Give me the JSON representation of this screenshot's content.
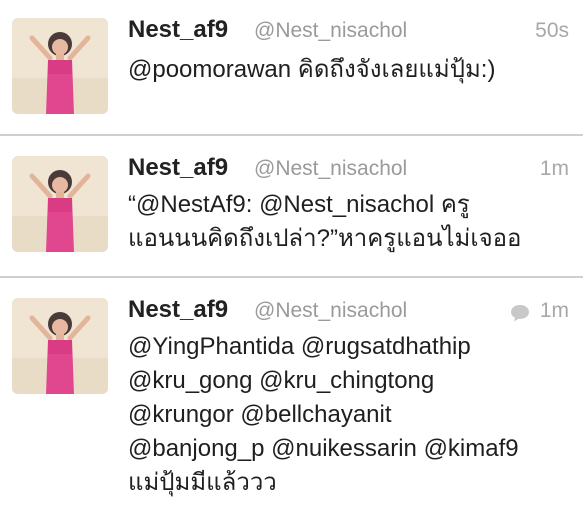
{
  "tweets": [
    {
      "name": "Nest_af9",
      "handle": "@Nest_nisachol",
      "time": "50s",
      "lines": [
        "@poomorawan คิดถึงจังเลยแม่ปุ้ม:)"
      ]
    },
    {
      "name": "Nest_af9",
      "handle": "@Nest_nisachol",
      "time": "1m",
      "lines": [
        "“@NestAf9: @Nest_nisachol ครู",
        "แอนนนคิดถึงเปล่า?”หาครูแอนไม่เจออ"
      ]
    },
    {
      "name": "Nest_af9",
      "handle": "@Nest_nisachol",
      "time": "1m",
      "reply_icon": "conversation-bubble-icon",
      "lines": [
        "@YingPhantida @rugsatdhathip",
        "@kru_gong @kru_chingtong",
        "@krungor @bellchayanit",
        "@banjong_p @nuikessarin @kimaf9",
        "แม่ปุ้มมีแล้ววว"
      ]
    }
  ],
  "colors": {
    "name": "#222222",
    "handle": "#9a9a9a",
    "time": "#a8a8a8",
    "divider": "#cfcfcf"
  }
}
